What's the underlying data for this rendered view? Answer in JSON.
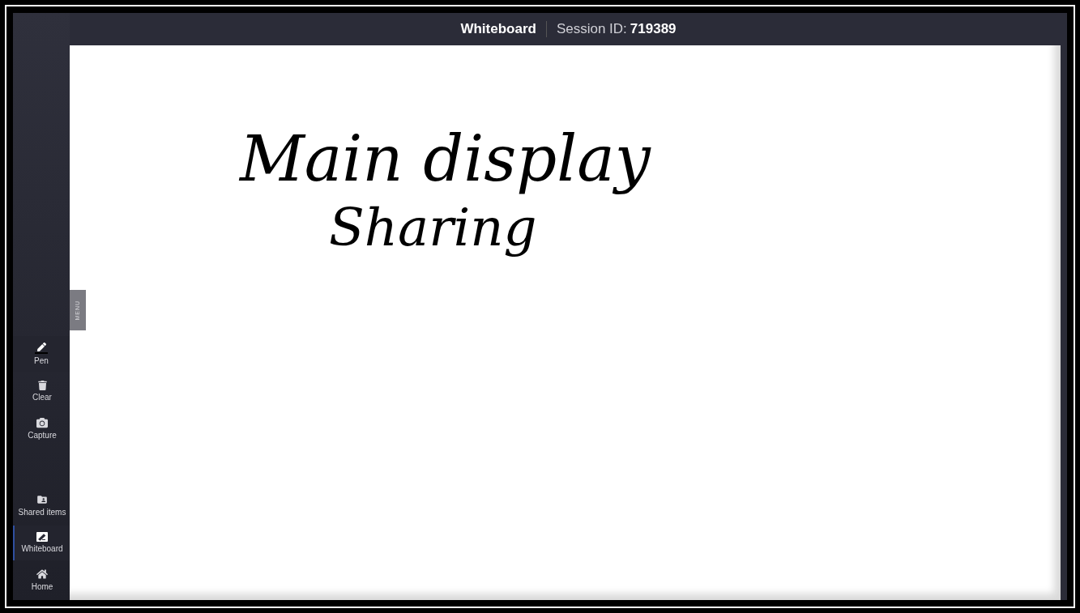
{
  "header": {
    "title": "Whiteboard",
    "session_label": "Session ID:",
    "session_id": "719389"
  },
  "menu_tab": {
    "label": "MENU"
  },
  "tools": [
    {
      "kind": "pen",
      "label": "Pen",
      "selected": true
    },
    {
      "kind": "trash",
      "label": "Clear",
      "selected": false
    },
    {
      "kind": "camera",
      "label": "Capture",
      "selected": false
    }
  ],
  "nav": [
    {
      "kind": "folder",
      "label": "Shared items",
      "selected": false
    },
    {
      "kind": "whiteboard",
      "label": "Whiteboard",
      "selected": true
    },
    {
      "kind": "home",
      "label": "Home",
      "selected": false
    }
  ],
  "canvas": {
    "lines": [
      "Main display",
      "Sharing"
    ]
  }
}
